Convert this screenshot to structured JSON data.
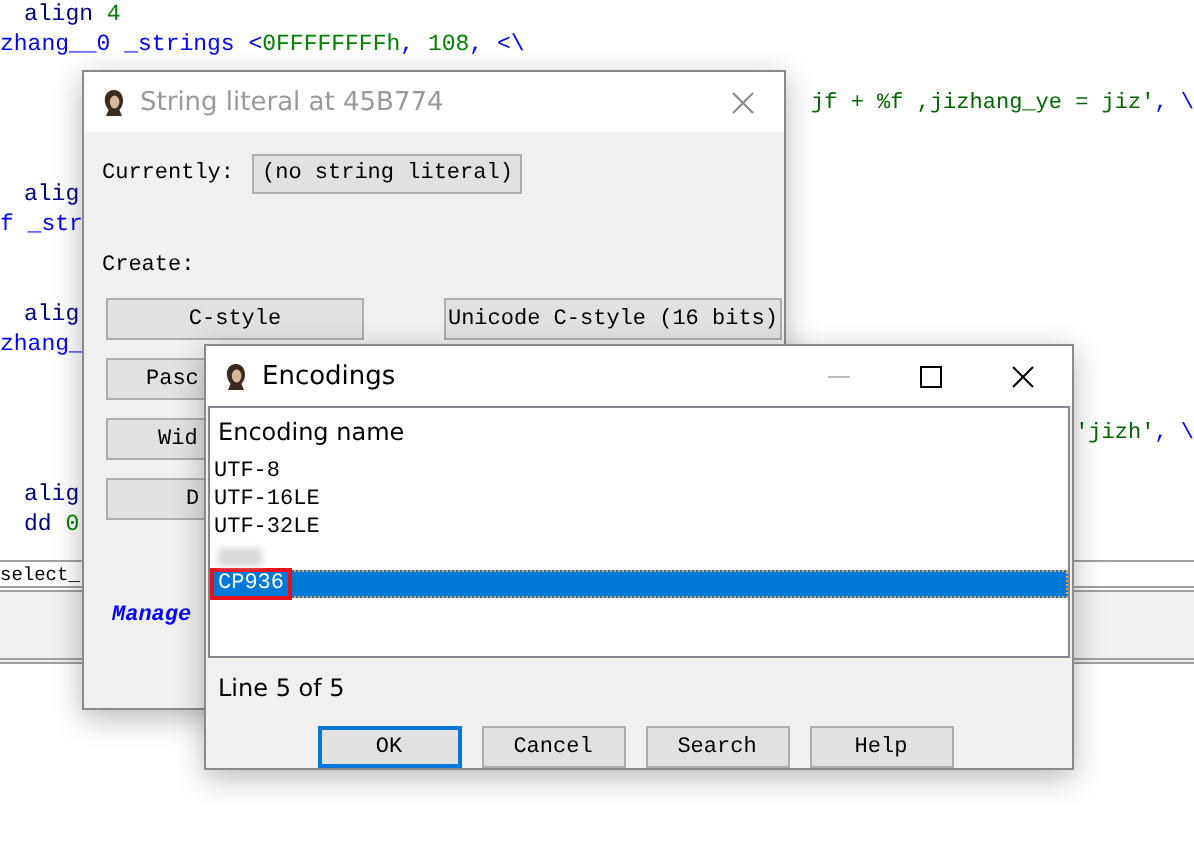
{
  "code_lines": [
    {
      "kind": "instruction",
      "tokens": [
        {
          "text": "align",
          "kind": "keyword"
        },
        {
          "text": " 4",
          "kind": "number"
        }
      ]
    },
    {
      "kind": "label",
      "tokens": [
        {
          "text": "zhang__0 _strings <",
          "kind": "name"
        },
        {
          "text": "0FFFFFFFFh",
          "kind": "number"
        },
        {
          "text": ", ",
          "kind": "name"
        },
        {
          "text": "108",
          "kind": "number"
        },
        {
          "text": ", <\\",
          "kind": "name"
        }
      ]
    },
    {
      "kind": "blank"
    },
    {
      "kind": "continuation",
      "tokens": [
        {
          "text": "jf + %f ,jizhang_ye = jiz'",
          "kind": "string"
        },
        {
          "text": ", \\",
          "kind": "name"
        }
      ]
    },
    {
      "kind": "blank"
    },
    {
      "kind": "blank"
    },
    {
      "kind": "instruction",
      "tokens": [
        {
          "text": "alig",
          "kind": "keyword"
        }
      ]
    },
    {
      "kind": "label",
      "tokens": [
        {
          "text": "f _str",
          "kind": "name"
        }
      ]
    },
    {
      "kind": "blank"
    },
    {
      "kind": "blank"
    },
    {
      "kind": "instruction",
      "tokens": [
        {
          "text": "alig",
          "kind": "keyword"
        }
      ]
    },
    {
      "kind": "label",
      "tokens": [
        {
          "text": "zhang_",
          "kind": "name"
        }
      ]
    },
    {
      "kind": "blank"
    },
    {
      "kind": "blank"
    },
    {
      "kind": "continuation",
      "tokens": [
        {
          "text": "'jizh'",
          "kind": "string"
        },
        {
          "text": ", \\",
          "kind": "name"
        }
      ]
    },
    {
      "kind": "blank"
    },
    {
      "kind": "instruction",
      "tokens": [
        {
          "text": "alig",
          "kind": "keyword"
        }
      ]
    },
    {
      "kind": "instruction",
      "tokens": [
        {
          "text": "dd ",
          "kind": "keyword"
        },
        {
          "text": "0",
          "kind": "number"
        }
      ]
    }
  ],
  "lower_pane": {
    "text": "select_"
  },
  "string_literal_dialog": {
    "title": "String literal at 45B774",
    "active": false,
    "currently_label": "Currently:",
    "currently_value": "(no string literal)",
    "create_label": "Create:",
    "button_rows": [
      [
        "C-style",
        "Unicode C-style (16 bits)"
      ],
      [
        "Pasc"
      ],
      [
        "Wid"
      ],
      [
        "D"
      ]
    ],
    "link": "Manage"
  },
  "encodings_dialog": {
    "title": "Encodings",
    "active": true,
    "column_header": "Encoding name",
    "items": [
      {
        "kind": "text",
        "label": "UTF-8",
        "selected": false
      },
      {
        "kind": "text",
        "label": "UTF-16LE",
        "selected": false
      },
      {
        "kind": "text",
        "label": "UTF-32LE",
        "selected": false
      },
      {
        "kind": "redacted",
        "selected": false
      },
      {
        "kind": "text",
        "label": "CP936",
        "selected": true,
        "highlighted": true
      }
    ],
    "status": "Line 5 of 5",
    "buttons": [
      {
        "label": "OK",
        "default": true
      },
      {
        "label": "Cancel",
        "default": false
      },
      {
        "label": "Search",
        "default": false
      },
      {
        "label": "Help",
        "default": false
      }
    ]
  }
}
